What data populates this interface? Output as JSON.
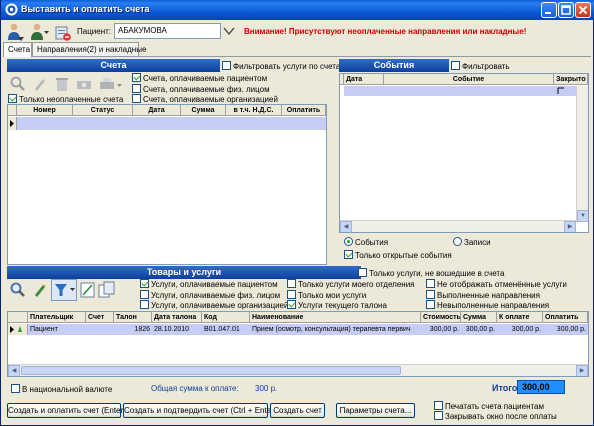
{
  "window": {
    "title": "Выставить и оплатить счета"
  },
  "toolbar": {
    "patient_label": "Пациент:",
    "patient_value": "АБАКУМОВА",
    "warning": "Внимание! Присутствуют неоплаченные направления или накладные!"
  },
  "tabs": [
    {
      "label": "Счета",
      "active": true
    },
    {
      "label": "Направления(2) и накладные",
      "active": false
    }
  ],
  "accounts": {
    "header": "Счета",
    "filter_label": "Фильтровать услуги по счетам",
    "options": [
      {
        "label": "Счета, оплачиваемые пациентом",
        "checked": true
      },
      {
        "label": "Счета, оплачиваемые физ. лицом",
        "checked": false
      },
      {
        "label": "Счета, оплачиваемые организацией",
        "checked": false
      }
    ],
    "unpaid_only": {
      "label": "Только неоплаченные счета",
      "checked": true
    },
    "columns": [
      "Номер",
      "Статус",
      "Дата",
      "Сумма",
      "в т.ч. Н.Д.С.",
      "Оплатить"
    ]
  },
  "events": {
    "header": "События",
    "filter_label": "Фильтровать",
    "columns": [
      "Дата",
      "Событие",
      "Закрыто"
    ],
    "radio": [
      {
        "label": "События",
        "checked": true
      },
      {
        "label": "Записи",
        "checked": false
      }
    ],
    "open_only": {
      "label": "Только открытые события",
      "checked": true
    }
  },
  "goods": {
    "header": "Товары и услуги",
    "not_in_account": {
      "label": "Только услуги, не вошедшие в счета",
      "checked": false
    },
    "col1": [
      {
        "label": "Услуги, оплачиваемые пациентом",
        "checked": true
      },
      {
        "label": "Услуги, оплачиваемые физ. лицом",
        "checked": false
      },
      {
        "label": "Услуги, оплачиваемые организацией",
        "checked": false
      }
    ],
    "col2": [
      {
        "label": "Только услуги моего отделения",
        "checked": false
      },
      {
        "label": "Только мои услуги",
        "checked": false
      },
      {
        "label": "Услуги текущего талона",
        "checked": true
      }
    ],
    "col3": [
      {
        "label": "Не отображать отменённые услуги",
        "checked": false
      },
      {
        "label": "Выполненные направления",
        "checked": false
      },
      {
        "label": "Невыполненные направления",
        "checked": false
      }
    ],
    "columns": [
      "Плательщик",
      "Счет",
      "Талон",
      "Дата талона",
      "Код",
      "Наименование",
      "Стоимость",
      "Сумма",
      "К оплате",
      "Оплатить"
    ],
    "rows": [
      {
        "payer": "Пациент",
        "account": "",
        "ticket": "1826",
        "ticket_date": "28.10.2010",
        "code": "B01.047.01",
        "name": "Прием (осмотр, консультация) терапевта первич",
        "cost": "300,00 р.",
        "sum": "300,00 р.",
        "to_pay": "300,00 р.",
        "pay": "300,00 р."
      }
    ]
  },
  "footer": {
    "national_currency": {
      "label": "В национальной валюте",
      "checked": false
    },
    "total_to_pay_label": "Общая сумма к оплате:",
    "total_to_pay_value": "300 р.",
    "itogo_label": "Итого:",
    "itogo_value": "300,00"
  },
  "buttons": {
    "create_pay": "Создать и оплатить счет (Enter)",
    "create_confirm": "Создать и подтвердить счет (Ctrl + Enter)",
    "create": "Создать счет",
    "params": "Параметры счета..."
  },
  "options": {
    "print_check": {
      "label": "Печатать счета пациентам",
      "checked": false
    },
    "close_after": {
      "label": "Закрывать окно после оплаты",
      "checked": false
    }
  },
  "colors": {
    "accent": "#0d3f9c",
    "warning": "#d00000",
    "selection": "#c5cdf4",
    "total_box": "#1e90ff"
  }
}
